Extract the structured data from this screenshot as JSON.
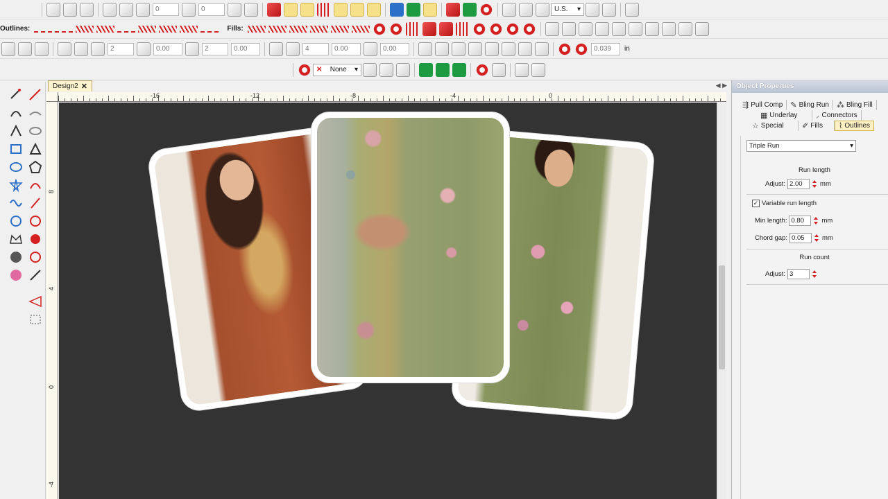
{
  "toolbar": {
    "outlines_label": "Outlines:",
    "fills_label": "Fills:",
    "spin_values": {
      "rotate_a": "0",
      "rotate_b": "0",
      "width_a": "2",
      "dim_a": "0.00",
      "width_b": "2",
      "dim_b": "0.00",
      "count_a": "4",
      "dim_c": "0.00",
      "dim_d": "0.00",
      "dim_e": "0.039",
      "unit": "in",
      "unit_small": "in"
    },
    "units_select": "U.S.",
    "effects_select": "None"
  },
  "document": {
    "tab_title": "Design2",
    "close_glyph": "✕"
  },
  "rulers": {
    "top_labels": [
      "-16",
      "-12",
      "-8",
      "-4",
      "0"
    ],
    "left_labels": [
      "8",
      "4",
      "0",
      "-4"
    ]
  },
  "panel": {
    "title": "Object Properties",
    "tabs_row1": [
      "Pull Comp",
      "Bling Run",
      "Bling Fill"
    ],
    "tabs_row2": [
      "Underlay",
      "Connectors"
    ],
    "tabs_row3": [
      "Special",
      "Fills",
      "Outlines"
    ],
    "active_tab": "Outlines",
    "stitch_type": "Triple Run",
    "run_length": {
      "heading": "Run length",
      "adjust_label": "Adjust:",
      "adjust_value": "2.00",
      "unit": "mm"
    },
    "variable": {
      "checkbox_label": "Variable run length",
      "checked": true,
      "min_label": "Min length:",
      "min_value": "0.80",
      "chord_label": "Chord gap:",
      "chord_value": "0.05",
      "unit": "mm"
    },
    "run_count": {
      "heading": "Run count",
      "adjust_label": "Adjust:",
      "adjust_value": "3"
    }
  },
  "colors": {
    "canvas": "#333333",
    "accent_red": "#d42020",
    "active_tab": "#fdf0c4"
  }
}
